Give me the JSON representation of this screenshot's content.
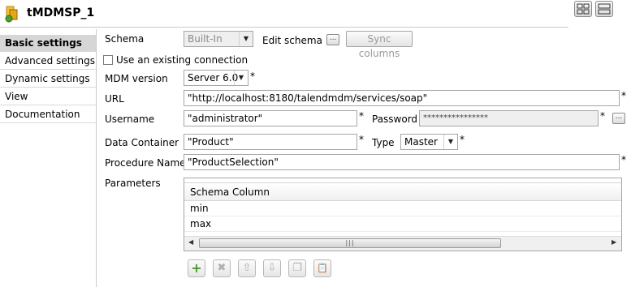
{
  "window": {
    "title": "tMDMSP_1"
  },
  "colors": {
    "nav_selected_bg": "#d6d6d6",
    "add_icon_green": "#4a9a2e",
    "disabled_text": "#9a9a9a"
  },
  "nav": {
    "items": [
      {
        "label": "Basic settings",
        "selected": true
      },
      {
        "label": "Advanced settings",
        "selected": false
      },
      {
        "label": "Dynamic settings",
        "selected": false
      },
      {
        "label": "View",
        "selected": false
      },
      {
        "label": "Documentation",
        "selected": false
      }
    ]
  },
  "form": {
    "schema": {
      "label": "Schema",
      "value": "Built-In",
      "edit_label": "Edit schema",
      "edit_btn": "...",
      "sync_label": "Sync columns"
    },
    "existing_connection": {
      "label": "Use an existing connection",
      "checked": false
    },
    "mdm_version": {
      "label": "MDM version",
      "value": "Server 6.0"
    },
    "url": {
      "label": "URL",
      "value": "\"http://localhost:8180/talendmdm/services/soap\""
    },
    "username": {
      "label": "Username",
      "value": "\"administrator\""
    },
    "password": {
      "label": "Password",
      "value": "****************",
      "btn": "..."
    },
    "data_container": {
      "label": "Data Container",
      "value": "\"Product\""
    },
    "type": {
      "label": "Type",
      "value": "Master"
    },
    "procedure_name": {
      "label": "Procedure Name",
      "value": "\"ProductSelection\""
    },
    "parameters": {
      "label": "Parameters",
      "column_header": "Schema Column",
      "rows": [
        "min",
        "max"
      ]
    },
    "required_marker": "*"
  },
  "toolbar": {
    "buttons": [
      {
        "name": "add-icon",
        "glyph": "+",
        "enabled": true
      },
      {
        "name": "remove-icon",
        "glyph": "✖",
        "enabled": false
      },
      {
        "name": "move-up-icon",
        "glyph": "⇧",
        "enabled": false
      },
      {
        "name": "move-down-icon",
        "glyph": "⇩",
        "enabled": false
      },
      {
        "name": "copy-icon",
        "glyph": "❐",
        "enabled": false
      },
      {
        "name": "paste-icon",
        "glyph": "📋",
        "enabled": false
      }
    ]
  }
}
